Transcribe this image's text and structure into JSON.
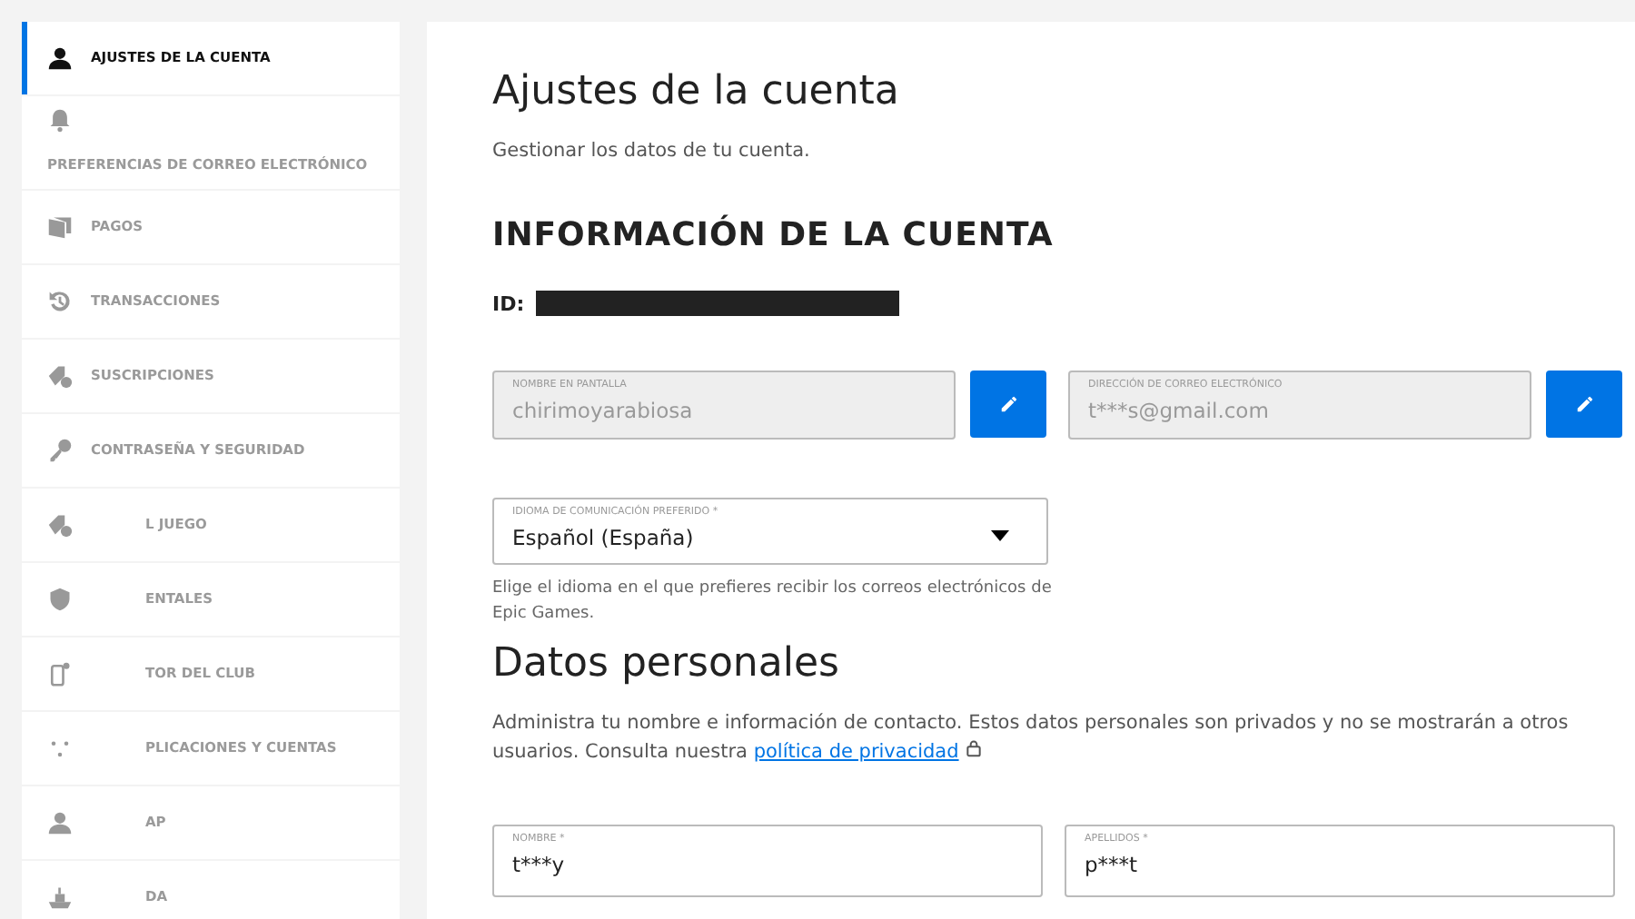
{
  "sidebar": {
    "items": [
      {
        "label": "AJUSTES DE LA CUENTA",
        "selected": true
      },
      {
        "label": "PREFERENCIAS DE CORREO ELECTRÓNICO",
        "selected": false
      },
      {
        "label": "PAGOS",
        "selected": false
      },
      {
        "label": "TRANSACCIONES",
        "selected": false
      },
      {
        "label": "SUSCRIPCIONES",
        "selected": false
      },
      {
        "label": "CONTRASEÑA Y SEGURIDAD",
        "selected": false
      },
      {
        "label": "L JUEGO",
        "selected": false
      },
      {
        "label": "ENTALES",
        "selected": false
      },
      {
        "label": "TOR DEL CLUB",
        "selected": false
      },
      {
        "label": "PLICACIONES Y CUENTAS",
        "selected": false
      },
      {
        "label": "AP",
        "selected": false
      },
      {
        "label": "DA",
        "selected": false
      }
    ]
  },
  "main": {
    "title": "Ajustes de la cuenta",
    "subtitle": "Gestionar los datos de tu cuenta.",
    "account_heading": "INFORMACIÓN DE LA CUENTA",
    "id_label": "ID:",
    "fields": [
      {
        "label": "NOMBRE EN PANTALLA",
        "value": "chirimoyarabiosa",
        "disabled": true
      },
      {
        "label": "DIRECCIÓN DE CORREO ELECTRÓNICO",
        "value": "t***s@gmail.com",
        "disabled": true
      }
    ],
    "language": {
      "label": "IDIOMA DE COMUNICACIÓN PREFERIDO *",
      "value": "Español (España)",
      "help": "Elige el idioma en el que prefieres recibir los correos electrónicos de Epic Games."
    },
    "personal_heading": "Datos personales",
    "personal_text": "Administra tu nombre e información de contacto. Estos datos personales son privados y no se mostrarán a otros usuarios. Consulta nuestra",
    "privacy_link": "política de privacidad",
    "name_fields": [
      {
        "label": "NOMBRE *",
        "value": "t***y"
      },
      {
        "label": "APELLIDOS *",
        "value": "p***t"
      }
    ]
  }
}
